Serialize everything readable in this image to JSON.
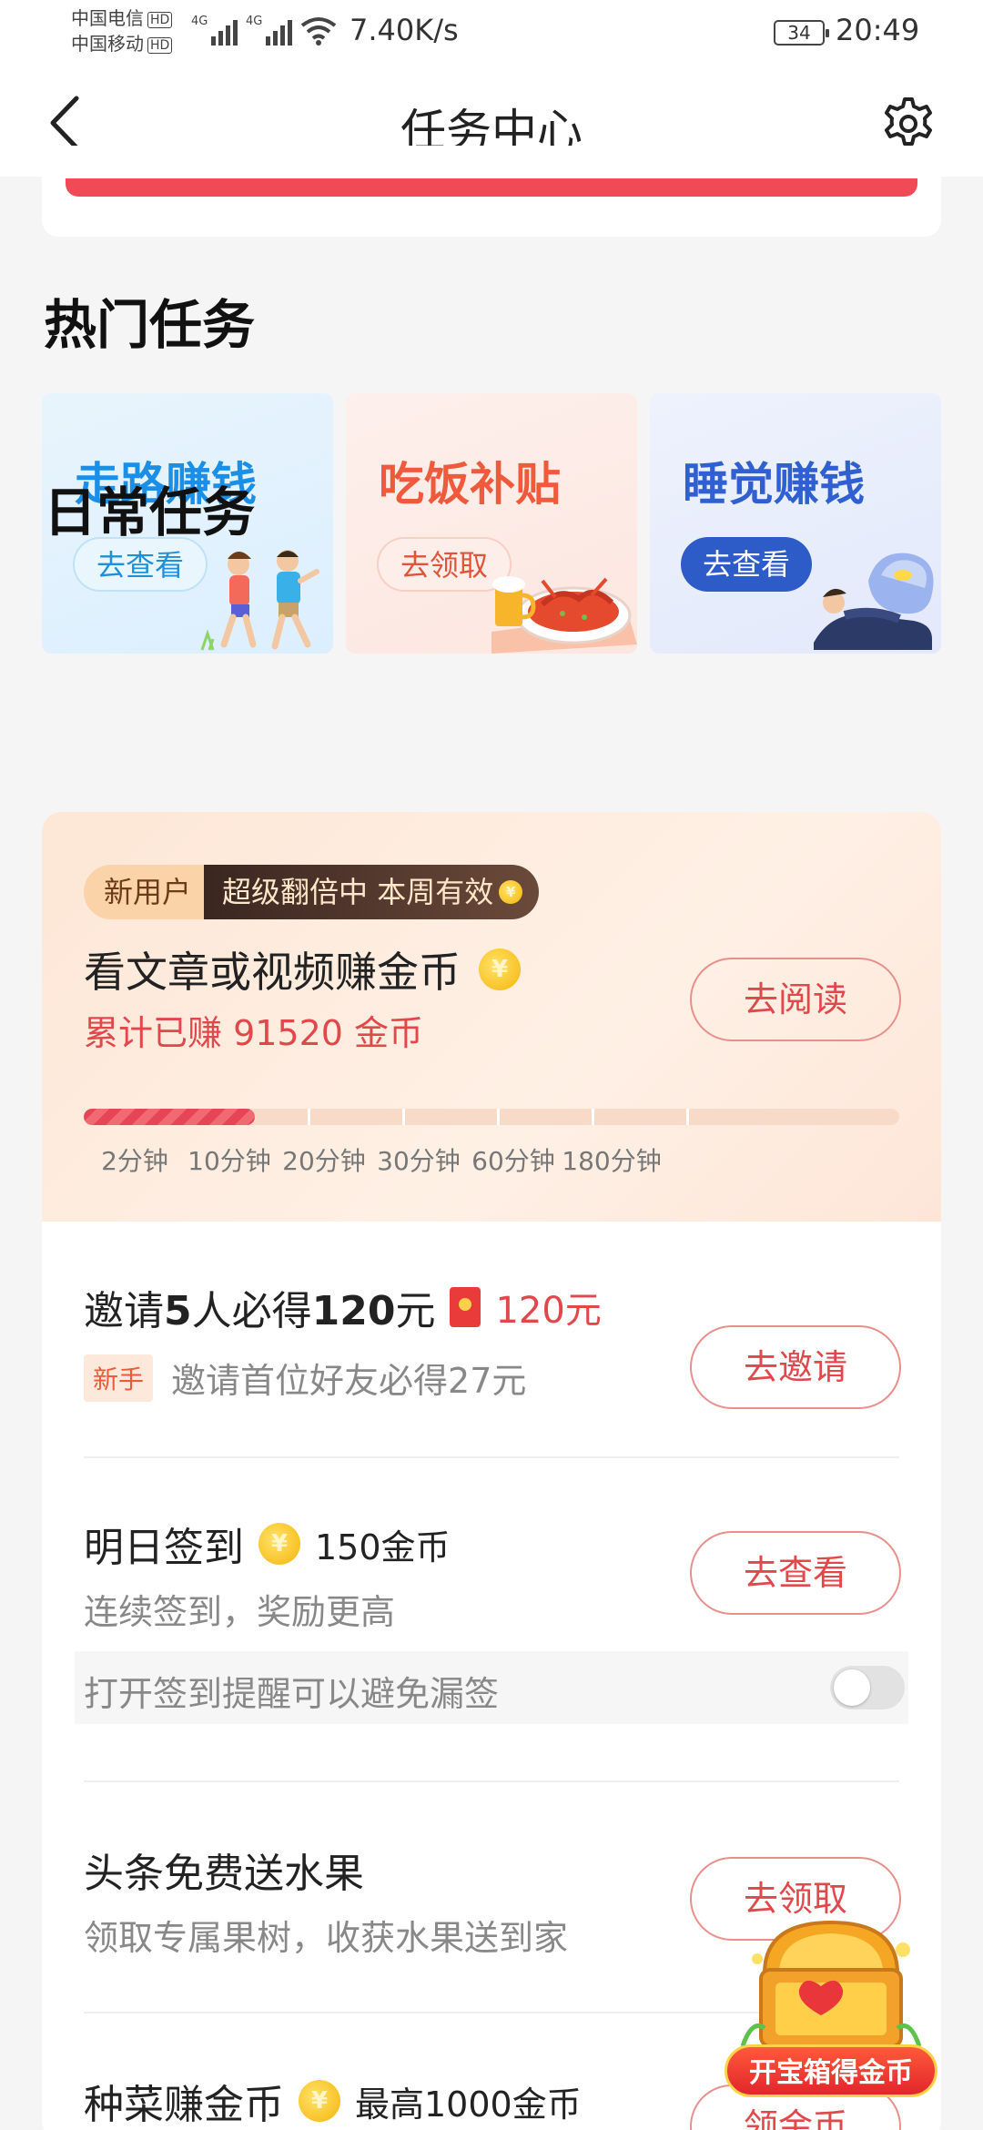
{
  "status": {
    "carrier1": "中国电信",
    "carrier2": "中国移动",
    "hd": "HD",
    "net_tag": "4G",
    "net_speed": "7.40K/s",
    "battery": "34",
    "time": "20:49"
  },
  "nav": {
    "title": "任务中心"
  },
  "hot": {
    "title": "热门任务",
    "cards": [
      {
        "title": "走路赚钱",
        "button": "去查看",
        "icon": "walking-people-illustration"
      },
      {
        "title": "吃饭补贴",
        "button": "去领取",
        "icon": "crayfish-beer-illustration"
      },
      {
        "title": "睡觉赚钱",
        "button": "去查看",
        "icon": "sleeping-person-illustration"
      }
    ]
  },
  "daily": {
    "title": "日常任务",
    "read": {
      "badge_new": "新用户",
      "badge_promo": "超级翻倍中 本周有效",
      "title": "看文章或视频赚金币",
      "earned": "累计已赚 91520 金币",
      "button": "去阅读",
      "progress_fraction": 0.21,
      "ticks": [
        "2分钟",
        "10分钟",
        "20分钟",
        "30分钟",
        "60分钟",
        "180分钟"
      ]
    },
    "invite": {
      "title_a": "邀请",
      "title_b": "5",
      "title_c": "人必得",
      "title_d": "120",
      "title_e": "元",
      "reward": "120元",
      "tag": "新手",
      "subtitle": "邀请首位好友必得27元",
      "button": "去邀请"
    },
    "checkin": {
      "title": "明日签到",
      "reward": "150金币",
      "subtitle": "连续签到，奖励更高",
      "button": "去查看",
      "reminder": "打开签到提醒可以避免漏签",
      "reminder_on": false
    },
    "fruit": {
      "title": "头条免费送水果",
      "subtitle": "领取专属果树，收获水果送到家",
      "button": "去领取"
    },
    "farm": {
      "title": "种菜赚金币",
      "reward": "最高1000金币",
      "button": "领金币"
    }
  },
  "floating": {
    "label": "开宝箱得金币",
    "icon": "treasure-chest-icon"
  },
  "colors": {
    "accent_red": "#e0484c",
    "walk_blue": "#1b8fe6",
    "eat_orange": "#f05a3c",
    "sleep_blue": "#2f5fd0"
  }
}
